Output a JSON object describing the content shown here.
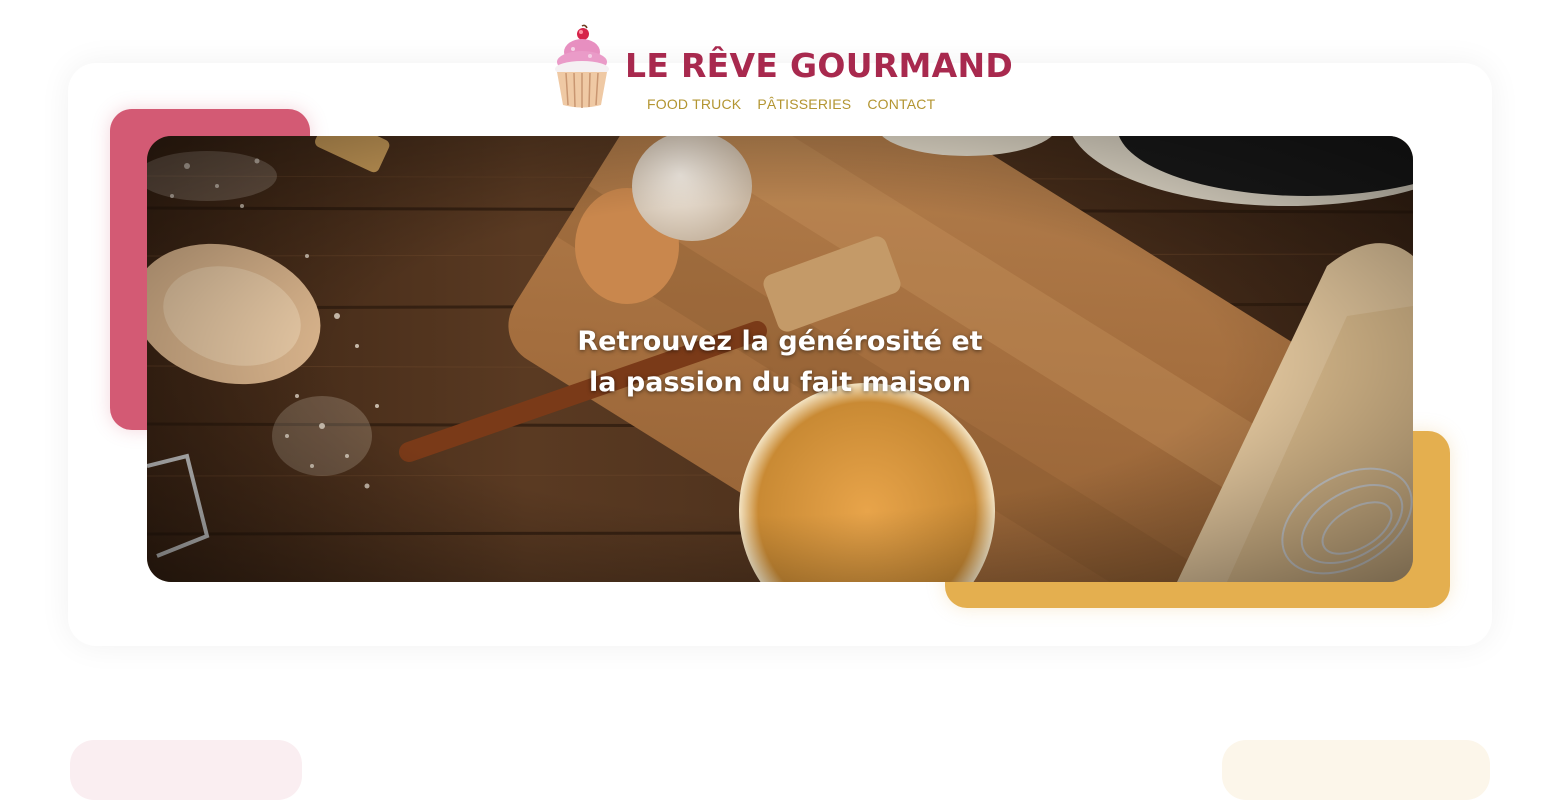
{
  "brand": {
    "name": "LE RÊVE GOURMAND",
    "logo_icon": "cupcake-icon"
  },
  "nav": {
    "items": [
      {
        "label": "FOOD TRUCK"
      },
      {
        "label": "PÂTISSERIES"
      },
      {
        "label": "CONTACT"
      }
    ]
  },
  "hero": {
    "image": "baking-ingredients-on-wooden-table",
    "headline_line1": "Retrouvez la générosité et",
    "headline_line2": "la passion du fait maison"
  },
  "colors": {
    "brand": "#a8294e",
    "nav": "#b39531",
    "accent_pink": "#d35a74",
    "accent_gold": "#e4af4f"
  }
}
